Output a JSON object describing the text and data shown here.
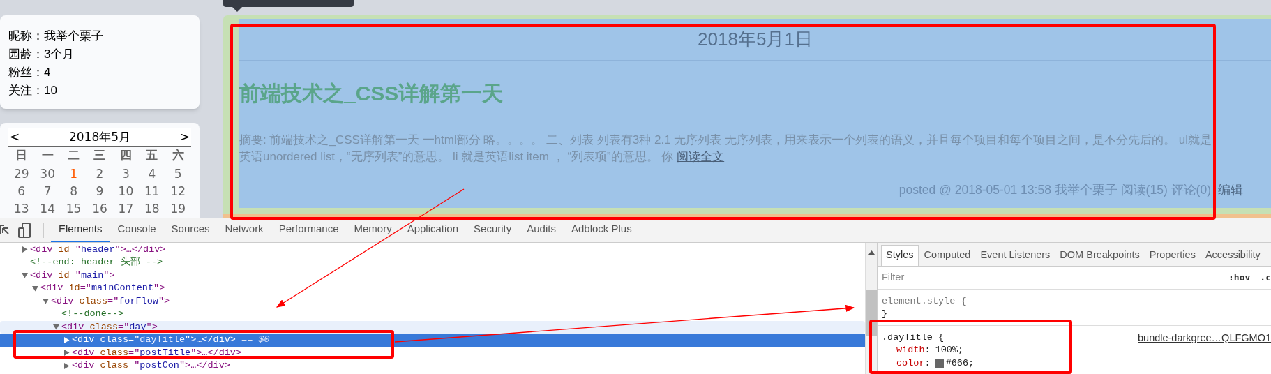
{
  "profile": [
    {
      "label": "昵称：",
      "value": "我举个栗子"
    },
    {
      "label": "园龄：",
      "value": "3个月"
    },
    {
      "label": "粉丝：",
      "value": "4"
    },
    {
      "label": "关注：",
      "value": "10"
    }
  ],
  "calendar": {
    "prev": "<",
    "title": "2018年5月",
    "next": ">",
    "weekdays": [
      "日",
      "一",
      "二",
      "三",
      "四",
      "五",
      "六"
    ],
    "weeks": [
      [
        {
          "day": "29",
          "today": false
        },
        {
          "day": "30",
          "today": false
        },
        {
          "day": "1",
          "today": true
        },
        {
          "day": "2",
          "today": false
        },
        {
          "day": "3",
          "today": false
        },
        {
          "day": "4",
          "today": false
        },
        {
          "day": "5",
          "today": false
        }
      ],
      [
        {
          "day": "6",
          "today": false
        },
        {
          "day": "7",
          "today": false
        },
        {
          "day": "8",
          "today": false
        },
        {
          "day": "9",
          "today": false
        },
        {
          "day": "10",
          "today": false
        },
        {
          "day": "11",
          "today": false
        },
        {
          "day": "12",
          "today": false
        }
      ],
      [
        {
          "day": "13",
          "today": false
        },
        {
          "day": "14",
          "today": false
        },
        {
          "day": "15",
          "today": false
        },
        {
          "day": "16",
          "today": false
        },
        {
          "day": "17",
          "today": false
        },
        {
          "day": "18",
          "today": false
        },
        {
          "day": "19",
          "today": false
        }
      ]
    ]
  },
  "post": {
    "date": "2018年5月1日",
    "title": "前端技术之_CSS详解第一天",
    "summary": "摘要: 前端技术之_CSS详解第一天 一html部分 略。。。。 二、列表 列表有3种 2.1 无序列表 无序列表，用来表示一个列表的语义，并且每个项目和每个项目之间，是不分先后的。 ul就是英语unordered list，“无序列表”的意思。 li 就是英语list item ， “列表项”的意思。 你 ",
    "read_more": "阅读全文",
    "footer": "posted @ 2018-05-01 13:58 我举个栗子 阅读(15) 评论(0)",
    "edit": "编辑"
  },
  "devtools": {
    "tabs": [
      {
        "label": "Elements",
        "selected": true
      },
      {
        "label": "Console",
        "selected": false
      },
      {
        "label": "Sources",
        "selected": false
      },
      {
        "label": "Network",
        "selected": false
      },
      {
        "label": "Performance",
        "selected": false
      },
      {
        "label": "Memory",
        "selected": false
      },
      {
        "label": "Application",
        "selected": false
      },
      {
        "label": "Security",
        "selected": false
      },
      {
        "label": "Audits",
        "selected": false
      },
      {
        "label": "Adblock Plus",
        "selected": false
      }
    ],
    "dom": [
      {
        "code": [
          {
            "kind": "tag",
            "s": "<div "
          },
          {
            "kind": "attr",
            "s": "id"
          },
          {
            "kind": "tag",
            "s": "=\""
          },
          {
            "kind": "val",
            "s": "header"
          },
          {
            "kind": "tag",
            "s": "\">…</div>"
          }
        ],
        "expanded": false,
        "selected": false,
        "hovered": false
      },
      {
        "code": [
          {
            "kind": "comment",
            "s": "<!--end: header 头部 -->"
          }
        ],
        "selected": false,
        "hovered": false
      },
      {
        "code": [
          {
            "kind": "tag",
            "s": "<div "
          },
          {
            "kind": "attr",
            "s": "id"
          },
          {
            "kind": "tag",
            "s": "=\""
          },
          {
            "kind": "val",
            "s": "main"
          },
          {
            "kind": "tag",
            "s": "\">"
          }
        ],
        "expanded": true,
        "selected": false,
        "hovered": false,
        "children": [
          {
            "code": [
              {
                "kind": "tag",
                "s": "<div "
              },
              {
                "kind": "attr",
                "s": "id"
              },
              {
                "kind": "tag",
                "s": "=\""
              },
              {
                "kind": "val",
                "s": "mainContent"
              },
              {
                "kind": "tag",
                "s": "\">"
              }
            ],
            "expanded": true,
            "selected": false,
            "hovered": false,
            "children": [
              {
                "code": [
                  {
                    "kind": "tag",
                    "s": "<div "
                  },
                  {
                    "kind": "attr",
                    "s": "class"
                  },
                  {
                    "kind": "tag",
                    "s": "=\""
                  },
                  {
                    "kind": "val",
                    "s": "forFlow"
                  },
                  {
                    "kind": "tag",
                    "s": "\">"
                  }
                ],
                "expanded": true,
                "selected": false,
                "hovered": false,
                "children": [
                  {
                    "code": [
                      {
                        "kind": "comment",
                        "s": "<!--done-->"
                      }
                    ],
                    "selected": false,
                    "hovered": false
                  },
                  {
                    "code": [
                      {
                        "kind": "tag",
                        "s": "<div "
                      },
                      {
                        "kind": "attr",
                        "s": "class"
                      },
                      {
                        "kind": "tag",
                        "s": "=\""
                      },
                      {
                        "kind": "val",
                        "s": "day"
                      },
                      {
                        "kind": "tag",
                        "s": "\">"
                      }
                    ],
                    "expanded": true,
                    "selected": false,
                    "hovered": true,
                    "children": [
                      {
                        "code": [
                          {
                            "kind": "tag",
                            "s": "<div "
                          },
                          {
                            "kind": "attr",
                            "s": "class"
                          },
                          {
                            "kind": "tag",
                            "s": "=\""
                          },
                          {
                            "kind": "val",
                            "s": "dayTitle"
                          },
                          {
                            "kind": "tag",
                            "s": "\">…</div>"
                          },
                          {
                            "kind": "ghost",
                            "s": " == $0"
                          }
                        ],
                        "expanded": false,
                        "selected": true,
                        "hovered": false
                      },
                      {
                        "code": [
                          {
                            "kind": "tag",
                            "s": "<div "
                          },
                          {
                            "kind": "attr",
                            "s": "class"
                          },
                          {
                            "kind": "tag",
                            "s": "=\""
                          },
                          {
                            "kind": "val",
                            "s": "postTitle"
                          },
                          {
                            "kind": "tag",
                            "s": "\">…</div>"
                          }
                        ],
                        "expanded": false,
                        "selected": false,
                        "hovered": false
                      },
                      {
                        "code": [
                          {
                            "kind": "tag",
                            "s": "<div "
                          },
                          {
                            "kind": "attr",
                            "s": "class"
                          },
                          {
                            "kind": "tag",
                            "s": "=\""
                          },
                          {
                            "kind": "val",
                            "s": "postCon"
                          },
                          {
                            "kind": "tag",
                            "s": "\">…</div>"
                          }
                        ],
                        "expanded": false,
                        "selected": false,
                        "hovered": false
                      }
                    ]
                  }
                ]
              }
            ]
          }
        ]
      }
    ],
    "side_tabs": [
      {
        "label": "Styles",
        "selected": true
      },
      {
        "label": "Computed",
        "selected": false
      },
      {
        "label": "Event Listeners",
        "selected": false
      },
      {
        "label": "DOM Breakpoints",
        "selected": false
      },
      {
        "label": "Properties",
        "selected": false
      },
      {
        "label": "Accessibility",
        "selected": false
      }
    ],
    "filter": {
      "placeholder": "Filter",
      "toggles": [
        ":hov",
        ".c"
      ]
    },
    "rules": [
      {
        "selector": "element.style",
        "open": " {",
        "close": "}"
      },
      {
        "selector": ".dayTitle",
        "open": " {",
        "source": "bundle-darkgree…QLFGMO1",
        "props": [
          {
            "name": "width",
            "colon": ":",
            "value": "100%;"
          },
          {
            "name": "color",
            "colon": ":",
            "value": "#666;",
            "color": "#666666"
          }
        ]
      }
    ]
  }
}
